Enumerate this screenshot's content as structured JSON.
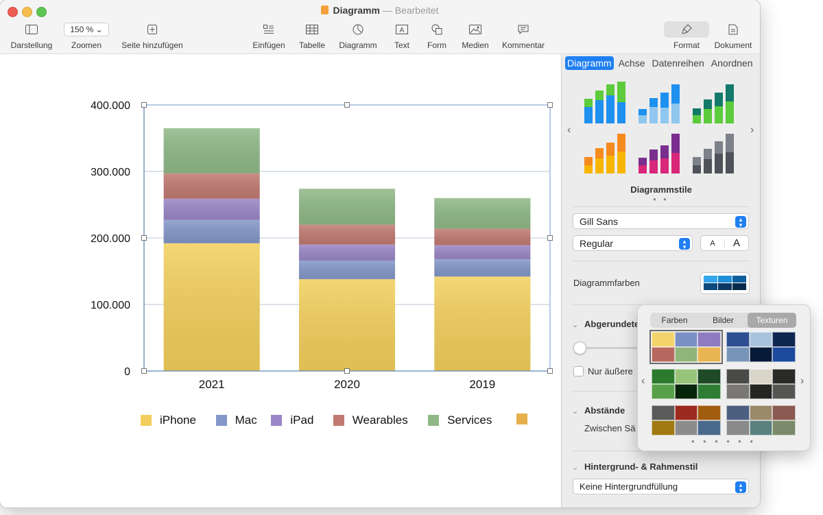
{
  "window": {
    "title": "Diagramm",
    "separator": "—",
    "status": "Bearbeitet"
  },
  "toolbar": {
    "items": [
      {
        "label": "Darstellung",
        "icon": "sidebar-icon"
      },
      {
        "label": "Zoomen",
        "value": "150 %",
        "icon": "chevron-down-icon"
      },
      {
        "label": "Seite hinzufügen",
        "icon": "add-page-icon"
      },
      {
        "label": "Einfügen",
        "icon": "insert-list-icon"
      },
      {
        "label": "Tabelle",
        "icon": "table-icon"
      },
      {
        "label": "Diagramm",
        "icon": "chart-icon"
      },
      {
        "label": "Text",
        "icon": "textbox-icon"
      },
      {
        "label": "Form",
        "icon": "shapes-icon"
      },
      {
        "label": "Medien",
        "icon": "photo-icon"
      },
      {
        "label": "Kommentar",
        "icon": "comment-icon"
      },
      {
        "label": "Format",
        "icon": "paintbrush-icon"
      },
      {
        "label": "Dokument",
        "icon": "document-icon"
      }
    ]
  },
  "sidebar": {
    "tabs": [
      "Diagramm",
      "Achse",
      "Datenreihen",
      "Anordnen"
    ],
    "styles_label": "Diagrammstile",
    "font": "Gill Sans",
    "font_style": "Regular",
    "font_smaller": "A",
    "font_larger": "A",
    "chart_colors_label": "Diagrammfarben",
    "rounded_label": "Abgerundete",
    "outer_only_label": "Nur äußere",
    "spacing_label": "Abstände",
    "between_label": "Zwischen Sä",
    "background_label": "Hintergrund- & Rahmenstil",
    "background_value": "Keine Hintergrundfüllung"
  },
  "color_popover": {
    "tabs": [
      "Farben",
      "Bilder",
      "Texturen"
    ],
    "active_tab": "Texturen",
    "palettes": [
      [
        "#f3d36b",
        "#7a8fc4",
        "#8f7bbf",
        "#b8695f",
        "#8fb57a",
        "#e8b552"
      ],
      [
        "#2e4f8f",
        "#a9c3dd",
        "#0f2650",
        "#7795b8",
        "#071a38",
        "#1d4a9c"
      ],
      [
        "#2b7a2e",
        "#98c47a",
        "#1e4a25",
        "#57a04a",
        "#06250a",
        "#2f7d35"
      ],
      [
        "#4a4a48",
        "#d9d5c8",
        "#2a2a28",
        "#7a7874",
        "#252523",
        "#555553"
      ],
      [
        "#5a5a5a",
        "#9c2a1e",
        "#a25c10",
        "#a07a10",
        "#8c8c8c",
        "#4a6a8c"
      ],
      [
        "#4d5f80",
        "#9a8a6a",
        "#8a5a50",
        "#8a8a8a",
        "#5a8080",
        "#7a8a6a"
      ]
    ]
  },
  "chart_data": {
    "type": "bar",
    "stacked": true,
    "categories": [
      "2021",
      "2020",
      "2019"
    ],
    "series": [
      {
        "name": "iPhone",
        "values": [
          192000,
          138000,
          142000
        ],
        "color": "#f2cf5c"
      },
      {
        "name": "Mac",
        "values": [
          35000,
          28000,
          26000
        ],
        "color": "#8397c8"
      },
      {
        "name": "iPad",
        "values": [
          32000,
          24000,
          21000
        ],
        "color": "#9a86c6"
      },
      {
        "name": "Wearables",
        "values": [
          38000,
          30000,
          25000
        ],
        "color": "#c07a72"
      },
      {
        "name": "Services",
        "values": [
          68000,
          54000,
          46000
        ],
        "color": "#8fb887"
      },
      {
        "name": "",
        "values": [
          0,
          0,
          0
        ],
        "color": "#e6b04c"
      }
    ],
    "ylim": [
      0,
      400000
    ],
    "yticks": [
      "0",
      "100.000",
      "200.000",
      "300.000",
      "400.000"
    ],
    "ytick_values": [
      0,
      100000,
      200000,
      300000,
      400000
    ],
    "grid": true,
    "legend": "bottom"
  }
}
